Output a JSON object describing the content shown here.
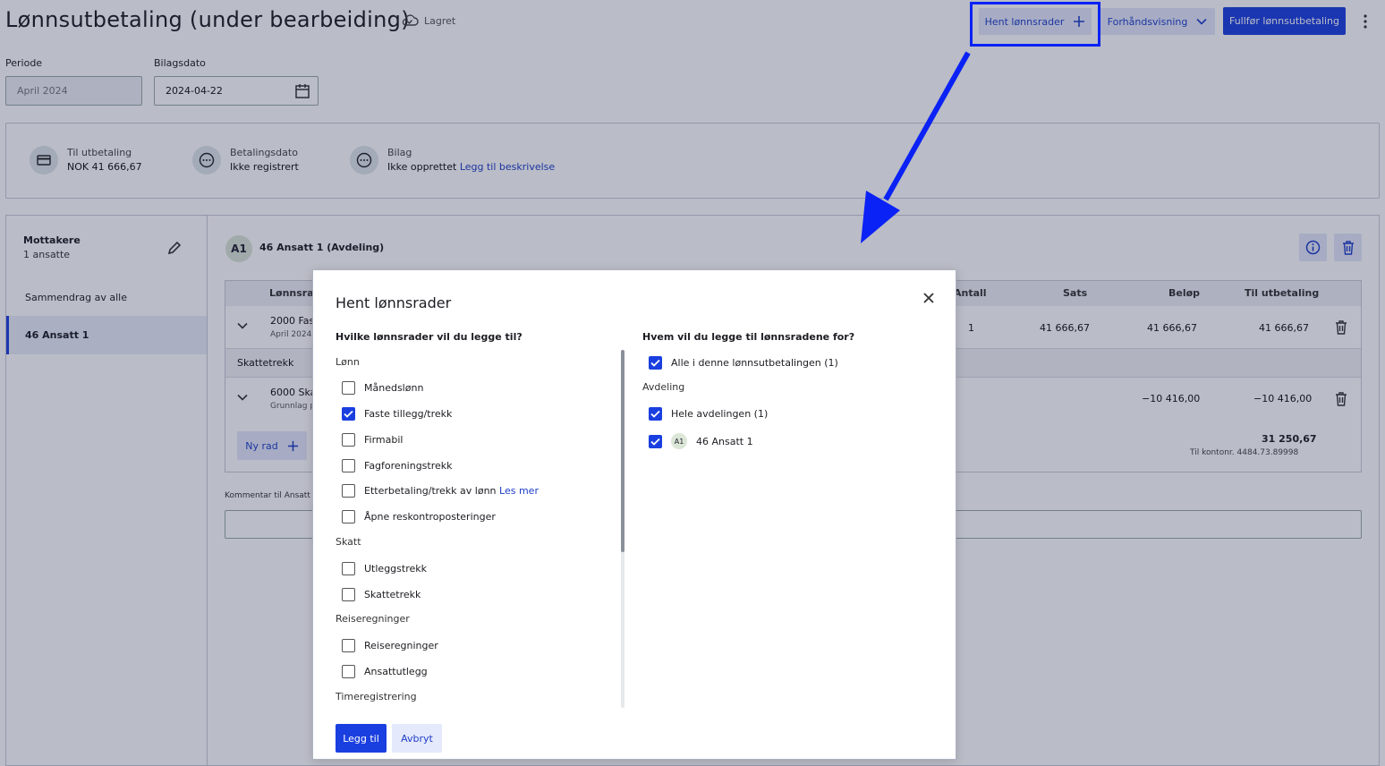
{
  "header": {
    "title": "Lønnsutbetaling (under bearbeiding)",
    "saved_label": "Lagret",
    "fetch_rows_button": "Hent lønnsrader",
    "preview_button": "Forhåndsvisning",
    "finish_button": "Fullfør lønnsutbetaling"
  },
  "form": {
    "period_label": "Periode",
    "period_value": "April 2024",
    "date_label": "Bilagsdato",
    "date_value": "2024-04-22"
  },
  "summary": {
    "payout_label": "Til utbetaling",
    "payout_value": "NOK 41 666,67",
    "paydate_label": "Betalingsdato",
    "paydate_value": "Ikke registrert",
    "voucher_label": "Bilag",
    "voucher_value": "Ikke opprettet",
    "voucher_link": "Legg til beskrivelse"
  },
  "sidebar": {
    "recipients_label": "Mottakere",
    "recipients_count": "1 ansatte",
    "summary_item": "Sammendrag av alle",
    "employee_item": "46 Ansatt 1"
  },
  "employee": {
    "initials": "A1",
    "name": "46 Ansatt 1 (Avdeling)"
  },
  "table": {
    "headers": {
      "lonnsrad": "Lønnsrad",
      "antall": "Antall",
      "sats": "Sats",
      "belop": "Beløp",
      "til_utbetaling": "Til utbetaling"
    },
    "row1": {
      "name": "2000 Fas",
      "sub": "April 2024",
      "antall": "1",
      "sats": "41 666,67",
      "belop": "41 666,67",
      "til": "41 666,67"
    },
    "section_skatt": "Skattetrekk",
    "row2": {
      "name": "6000 Ska",
      "sub": "Grunnlag p",
      "belop": "−10 416,00",
      "til": "−10 416,00"
    },
    "new_row": "Ny rad",
    "total": "31 250,67",
    "total_account": "Til kontonr. 4484.73.89998",
    "comment_label": "Kommentar til Ansatt 1"
  },
  "modal": {
    "title": "Hent lønnsrader",
    "left_question": "Hvilke lønnsrader vil du legge til?",
    "right_question": "Hvem vil du legge til lønnsradene for?",
    "groups": {
      "lonn": "Lønn",
      "skatt": "Skatt",
      "reise": "Reiseregninger",
      "timer": "Timeregistrering"
    },
    "items": {
      "manedslonn": "Månedslønn",
      "faste": "Faste tillegg/trekk",
      "firmabil": "Firmabil",
      "fagforening": "Fagforeningstrekk",
      "etterbetaling": "Etterbetaling/trekk av lønn",
      "etterbetaling_link": "Les mer",
      "apne": "Åpne reskontroposteringer",
      "utlegg": "Utleggstrekk",
      "skattetrekk": "Skattetrekk",
      "reiseregninger": "Reiseregninger",
      "ansattutlegg": "Ansattutlegg"
    },
    "right": {
      "all": "Alle i denne lønnsutbetalingen (1)",
      "avdeling": "Avdeling",
      "hele": "Hele avdelingen (1)",
      "emp_initials": "A1",
      "emp_name": "46 Ansatt 1"
    },
    "add_button": "Legg til",
    "cancel_button": "Avbryt"
  },
  "colors": {
    "accent": "#1a3fe0",
    "annotation": "#0a22f5"
  }
}
